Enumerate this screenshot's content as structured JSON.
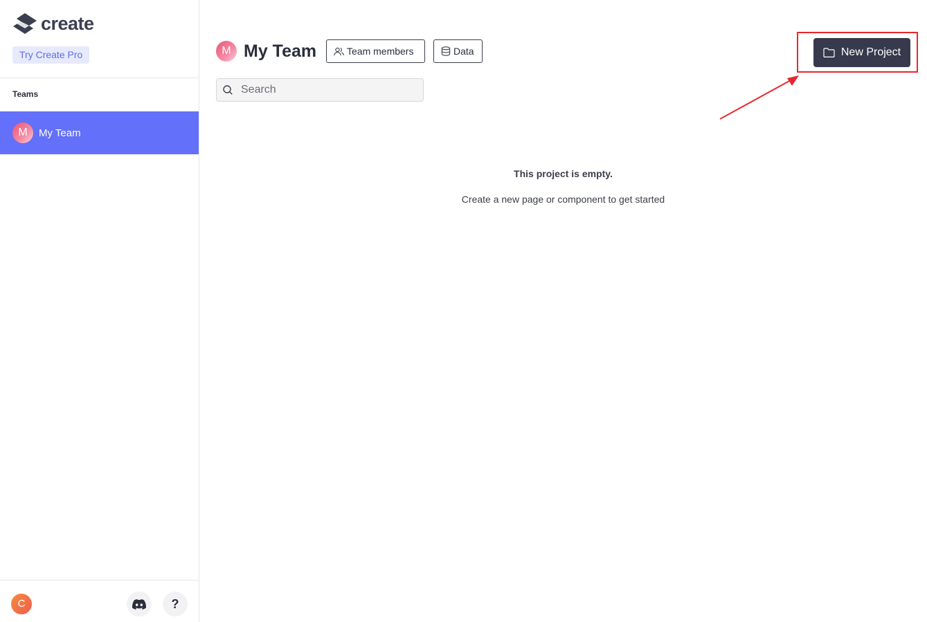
{
  "sidebar": {
    "brand": "create",
    "pro_badge": "Try Create Pro",
    "teams_label": "Teams",
    "teams": [
      {
        "initial": "M",
        "label": "My Team",
        "active": true
      }
    ],
    "user_initial": "C",
    "help_label": "?"
  },
  "header": {
    "team_initial": "M",
    "title": "My Team",
    "team_members_label": "Team members",
    "data_label": "Data",
    "new_project_label": "New Project"
  },
  "search": {
    "placeholder": "Search"
  },
  "empty_state": {
    "title": "This project is empty.",
    "subtitle": "Create a new page or component to get started"
  },
  "colors": {
    "accent": "#6370f9",
    "primary_button": "#373a4d",
    "annotation": "#e8262d"
  },
  "icons": [
    "create-logo-icon",
    "discord-icon",
    "users-icon",
    "database-icon",
    "search-icon",
    "folder-icon"
  ]
}
